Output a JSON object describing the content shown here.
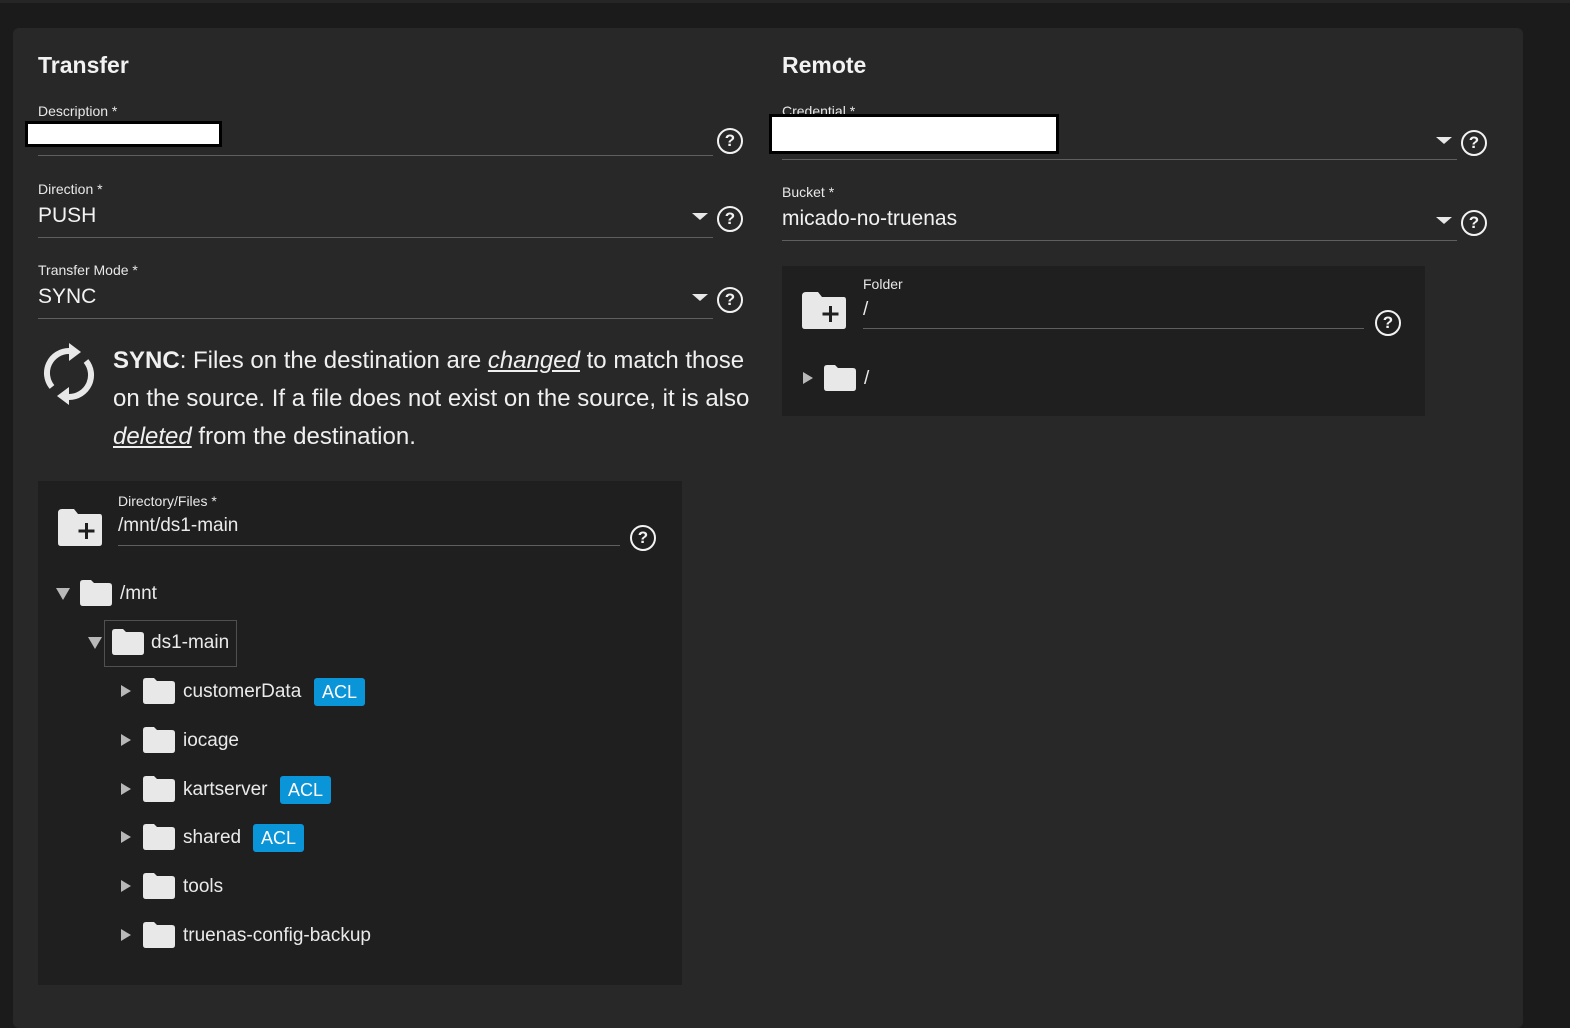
{
  "transfer": {
    "title": "Transfer",
    "description": {
      "label": "Description *",
      "value": ""
    },
    "direction": {
      "label": "Direction *",
      "value": "PUSH"
    },
    "transfer_mode": {
      "label": "Transfer Mode *",
      "value": "SYNC"
    },
    "mode_help": {
      "mode": "SYNC",
      "part1": ": Files on the destination are ",
      "em1": "changed",
      "part2": " to match those on the source. If a file does not exist on the source, it is also ",
      "em2": "deleted",
      "part3": " from the destination."
    },
    "explorer": {
      "label": "Directory/Files *",
      "value": "/mnt/ds1-main",
      "root": "/mnt",
      "selected": "ds1-main",
      "children": [
        {
          "name": "customerData",
          "badge": "ACL"
        },
        {
          "name": "iocage",
          "badge": ""
        },
        {
          "name": "kartserver",
          "badge": "ACL"
        },
        {
          "name": "shared",
          "badge": "ACL"
        },
        {
          "name": "tools",
          "badge": ""
        },
        {
          "name": "truenas-config-backup",
          "badge": ""
        }
      ]
    }
  },
  "remote": {
    "title": "Remote",
    "credential": {
      "label": "Credential *",
      "value": ""
    },
    "bucket": {
      "label": "Bucket *",
      "value": "micado-no-truenas"
    },
    "folder": {
      "label": "Folder",
      "value": "/",
      "root": "/"
    }
  },
  "icons": {
    "help": "help-circle-icon",
    "dropdown": "arrow-drop-down-icon",
    "sync": "sync-icon",
    "folder": "folder-icon",
    "add_folder": "create-new-folder-icon"
  },
  "colors": {
    "background": "#1b1b1b",
    "card": "#282828",
    "panel": "#1f1f1f",
    "acl_badge": "#0a95d9"
  }
}
